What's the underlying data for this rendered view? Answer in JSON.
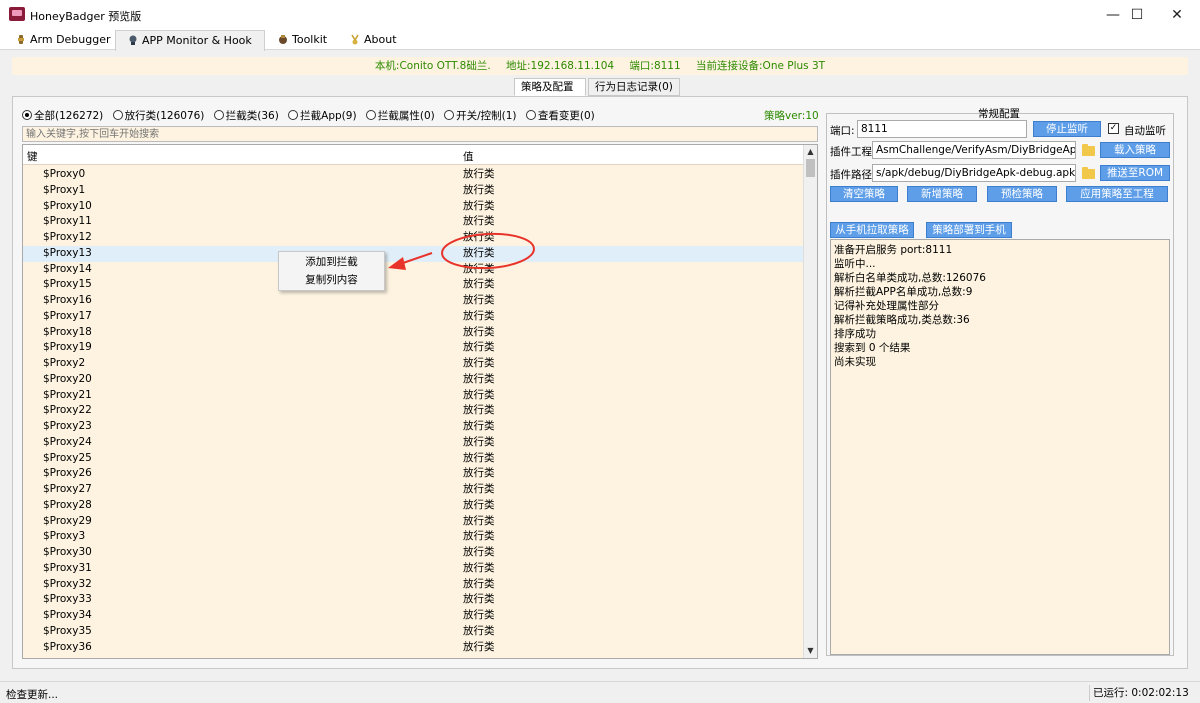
{
  "window": {
    "title": "HoneyBadger 预览版",
    "minimize_glyph": "—",
    "maximize_glyph": "☐",
    "close_glyph": "✕"
  },
  "tabs": [
    {
      "label": "Arm Debugger",
      "icon": "chip-icon"
    },
    {
      "label": "APP Monitor & Hook",
      "icon": "monitor-icon"
    },
    {
      "label": "Toolkit",
      "icon": "toolkit-icon"
    },
    {
      "label": "About",
      "icon": "about-icon"
    }
  ],
  "status_line": {
    "local": "本机:Conito OTT.8础兰.",
    "address": "地址:192.168.11.104",
    "port": "端口:8111",
    "device": "当前连接设备:One Plus 3T",
    "color": "#2d8a00"
  },
  "subtabs": [
    "策略及配置",
    "行为日志记录(0)"
  ],
  "filters": [
    {
      "label": "全部(126272)",
      "selected": true
    },
    {
      "label": "放行类(126076)",
      "selected": false
    },
    {
      "label": "拦截类(36)",
      "selected": false
    },
    {
      "label": "拦截App(9)",
      "selected": false
    },
    {
      "label": "拦截属性(0)",
      "selected": false
    },
    {
      "label": "开关/控制(1)",
      "selected": false
    },
    {
      "label": "查看变更(0)",
      "selected": false
    }
  ],
  "policy_version": "策略ver:10",
  "search": {
    "placeholder": "输入关键字,按下回车开始搜索"
  },
  "table": {
    "col_key": "键",
    "col_value": "值",
    "scroll_up": "▲",
    "scroll_down": "▼",
    "rows": [
      {
        "key": "$Proxy0",
        "value": "放行类"
      },
      {
        "key": "$Proxy1",
        "value": "放行类"
      },
      {
        "key": "$Proxy10",
        "value": "放行类"
      },
      {
        "key": "$Proxy11",
        "value": "放行类"
      },
      {
        "key": "$Proxy12",
        "value": "放行类"
      },
      {
        "key": "$Proxy13",
        "value": "放行类",
        "selected": true
      },
      {
        "key": "$Proxy14",
        "value": "放行类"
      },
      {
        "key": "$Proxy15",
        "value": "放行类"
      },
      {
        "key": "$Proxy16",
        "value": "放行类"
      },
      {
        "key": "$Proxy17",
        "value": "放行类"
      },
      {
        "key": "$Proxy18",
        "value": "放行类"
      },
      {
        "key": "$Proxy19",
        "value": "放行类"
      },
      {
        "key": "$Proxy2",
        "value": "放行类"
      },
      {
        "key": "$Proxy20",
        "value": "放行类"
      },
      {
        "key": "$Proxy21",
        "value": "放行类"
      },
      {
        "key": "$Proxy22",
        "value": "放行类"
      },
      {
        "key": "$Proxy23",
        "value": "放行类"
      },
      {
        "key": "$Proxy24",
        "value": "放行类"
      },
      {
        "key": "$Proxy25",
        "value": "放行类"
      },
      {
        "key": "$Proxy26",
        "value": "放行类"
      },
      {
        "key": "$Proxy27",
        "value": "放行类"
      },
      {
        "key": "$Proxy28",
        "value": "放行类"
      },
      {
        "key": "$Proxy29",
        "value": "放行类"
      },
      {
        "key": "$Proxy3",
        "value": "放行类"
      },
      {
        "key": "$Proxy30",
        "value": "放行类"
      },
      {
        "key": "$Proxy31",
        "value": "放行类"
      },
      {
        "key": "$Proxy32",
        "value": "放行类"
      },
      {
        "key": "$Proxy33",
        "value": "放行类"
      },
      {
        "key": "$Proxy34",
        "value": "放行类"
      },
      {
        "key": "$Proxy35",
        "value": "放行类"
      },
      {
        "key": "$Proxy36",
        "value": "放行类"
      }
    ]
  },
  "context_menu": [
    "添加到拦截",
    "复制列内容"
  ],
  "config": {
    "title": "常规配置",
    "port_label": "端口:",
    "port_value": "8111",
    "stop_button": "停止监听",
    "auto_listen_label": "自动监听",
    "auto_listen_checked": "✓",
    "plugin_project_label": "插件工程",
    "plugin_project_value": "AsmChallenge/VerifyAsm/DiyBridgeApk",
    "load_policy_button": "载入策略",
    "plugin_path_label": "插件路径",
    "plugin_path_value": "s/apk/debug/DiyBridgeApk-debug.apk",
    "push_rom_button": "推送至ROM",
    "clear_button": "清空策略",
    "add_button": "新增策略",
    "precheck_button": "预检策略",
    "apply_button": "应用策略至工程",
    "pull_button": "从手机拉取策略",
    "deploy_button": "策略部署到手机"
  },
  "log": [
    "准备开启服务 port:8111",
    "监听中...",
    "解析白名单类成功,总数:126076",
    "解析拦截APP名单成功,总数:9",
    "记得补充处理属性部分",
    "解析拦截策略成功,类总数:36",
    "排序成功",
    "搜索到 0 个结果",
    "尚未实现"
  ],
  "statusbar": {
    "left": "检查更新...",
    "right": "已运行: 0:02:02:13"
  },
  "accent_colors": {
    "button": "#5e9ee8",
    "annotation": "#e8332a",
    "selection": "#e0eef9"
  }
}
